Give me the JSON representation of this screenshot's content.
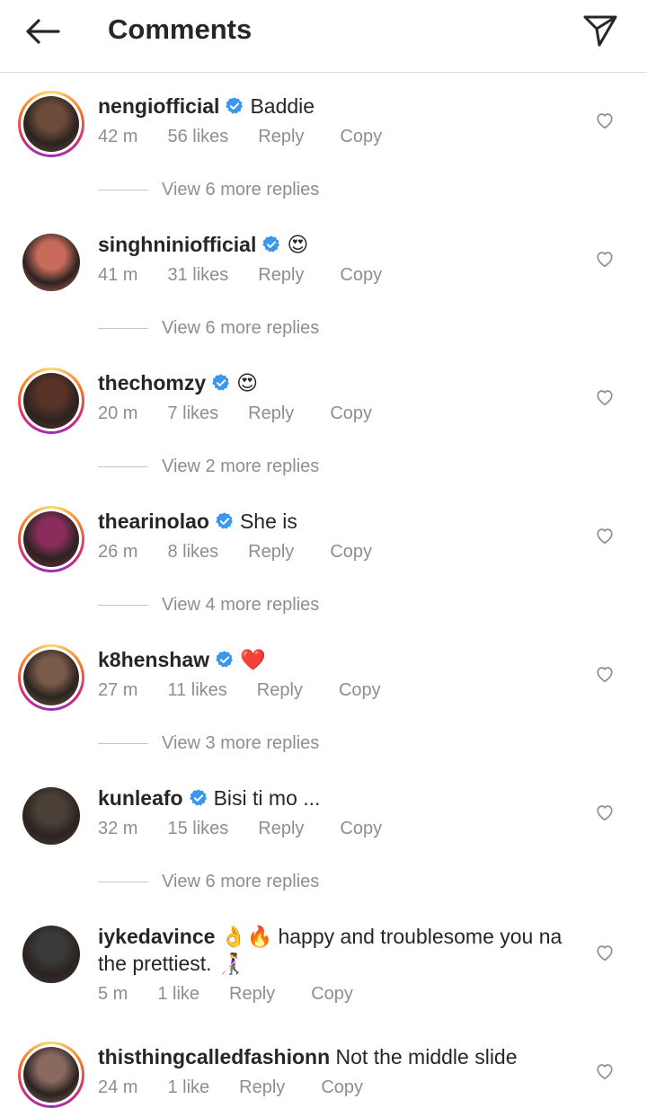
{
  "header": {
    "title": "Comments",
    "back_icon": "arrow-left-icon",
    "send_icon": "paper-plane-icon"
  },
  "colors": {
    "verified": "#3897f0",
    "meta": "#8e8e8e",
    "text": "#262626",
    "heart_emoji": "#e0245e"
  },
  "comments": [
    {
      "username": "nengiofficial",
      "verified": true,
      "text": "Baddie",
      "time": "42 m",
      "likes": "56 likes",
      "reply": "Reply",
      "copy": "Copy",
      "view_replies": "View 6 more replies",
      "story_ring": true,
      "avatar_color": "#6b4b3a"
    },
    {
      "username": "singhniniofficial",
      "verified": true,
      "text": "😍",
      "time": "41 m",
      "likes": "31 likes",
      "reply": "Reply",
      "copy": "Copy",
      "view_replies": "View 6 more replies",
      "story_ring": false,
      "avatar_color": "#c96b5a"
    },
    {
      "username": "thechomzy",
      "verified": true,
      "text": "😍",
      "time": "20 m",
      "likes": "7 likes",
      "reply": "Reply",
      "copy": "Copy",
      "view_replies": "View 2 more replies",
      "story_ring": true,
      "avatar_color": "#5a3328"
    },
    {
      "username": "thearinolao",
      "verified": true,
      "text": "She is",
      "time": "26 m",
      "likes": "8 likes",
      "reply": "Reply",
      "copy": "Copy",
      "view_replies": "View 4 more replies",
      "story_ring": true,
      "avatar_color": "#8a2d5c"
    },
    {
      "username": "k8henshaw",
      "verified": true,
      "text": "❤️",
      "time": "27 m",
      "likes": "11 likes",
      "reply": "Reply",
      "copy": "Copy",
      "view_replies": "View 3 more replies",
      "story_ring": true,
      "avatar_color": "#7a5a4a"
    },
    {
      "username": "kunleafo",
      "verified": true,
      "text": "Bisi ti mo ...",
      "time": "32 m",
      "likes": "15 likes",
      "reply": "Reply",
      "copy": "Copy",
      "view_replies": "View 6 more replies",
      "story_ring": false,
      "avatar_color": "#4a4038"
    },
    {
      "username": "iykedavince",
      "verified": false,
      "text": "👌🔥 happy and troublesome you na the prettiest. 👩‍🦯",
      "time": "5 m",
      "likes": "1 like",
      "reply": "Reply",
      "copy": "Copy",
      "view_replies": "",
      "story_ring": false,
      "avatar_color": "#3a3a3a"
    },
    {
      "username": "thisthingcalledfashionn",
      "verified": false,
      "text": "Not the middle slide",
      "time": "24 m",
      "likes": "1 like",
      "reply": "Reply",
      "copy": "Copy",
      "view_replies": "",
      "story_ring": true,
      "avatar_color": "#8a6a60"
    }
  ]
}
